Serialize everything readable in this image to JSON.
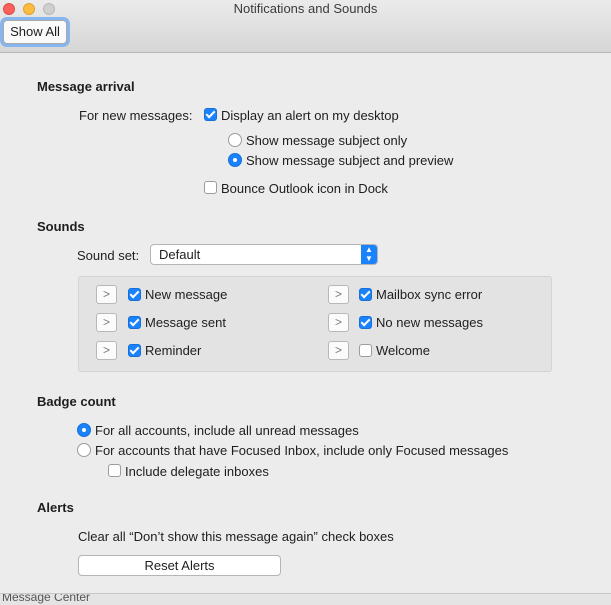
{
  "window": {
    "title": "Notifications and Sounds",
    "show_all_label": "Show All"
  },
  "message_arrival": {
    "heading": "Message arrival",
    "for_new_label": "For new messages:",
    "display_alert": {
      "label": "Display an alert on my desktop",
      "checked": true
    },
    "subject_only": {
      "label": "Show message subject only",
      "selected": false
    },
    "subject_preview": {
      "label": "Show message subject and preview",
      "selected": true
    },
    "bounce_icon": {
      "label": "Bounce Outlook icon in Dock",
      "checked": false
    }
  },
  "sounds": {
    "heading": "Sounds",
    "sound_set_label": "Sound set:",
    "sound_set_value": "Default",
    "items": [
      {
        "label": "New message",
        "checked": true
      },
      {
        "label": "Message sent",
        "checked": true
      },
      {
        "label": "Reminder",
        "checked": true
      },
      {
        "label": "Mailbox sync error",
        "checked": true
      },
      {
        "label": "No new messages",
        "checked": true
      },
      {
        "label": "Welcome",
        "checked": false
      }
    ]
  },
  "badge": {
    "heading": "Badge count",
    "all_unread": {
      "label": "For all accounts, include all unread messages",
      "selected": true
    },
    "focused_only": {
      "label": "For accounts that have Focused Inbox, include only Focused messages",
      "selected": false
    },
    "delegate": {
      "label": "Include delegate inboxes",
      "checked": false
    }
  },
  "alerts": {
    "heading": "Alerts",
    "description": "Clear all “Don’t show this message again” check boxes",
    "reset_label": "Reset Alerts"
  },
  "bottom_peek_text": "Message Center"
}
